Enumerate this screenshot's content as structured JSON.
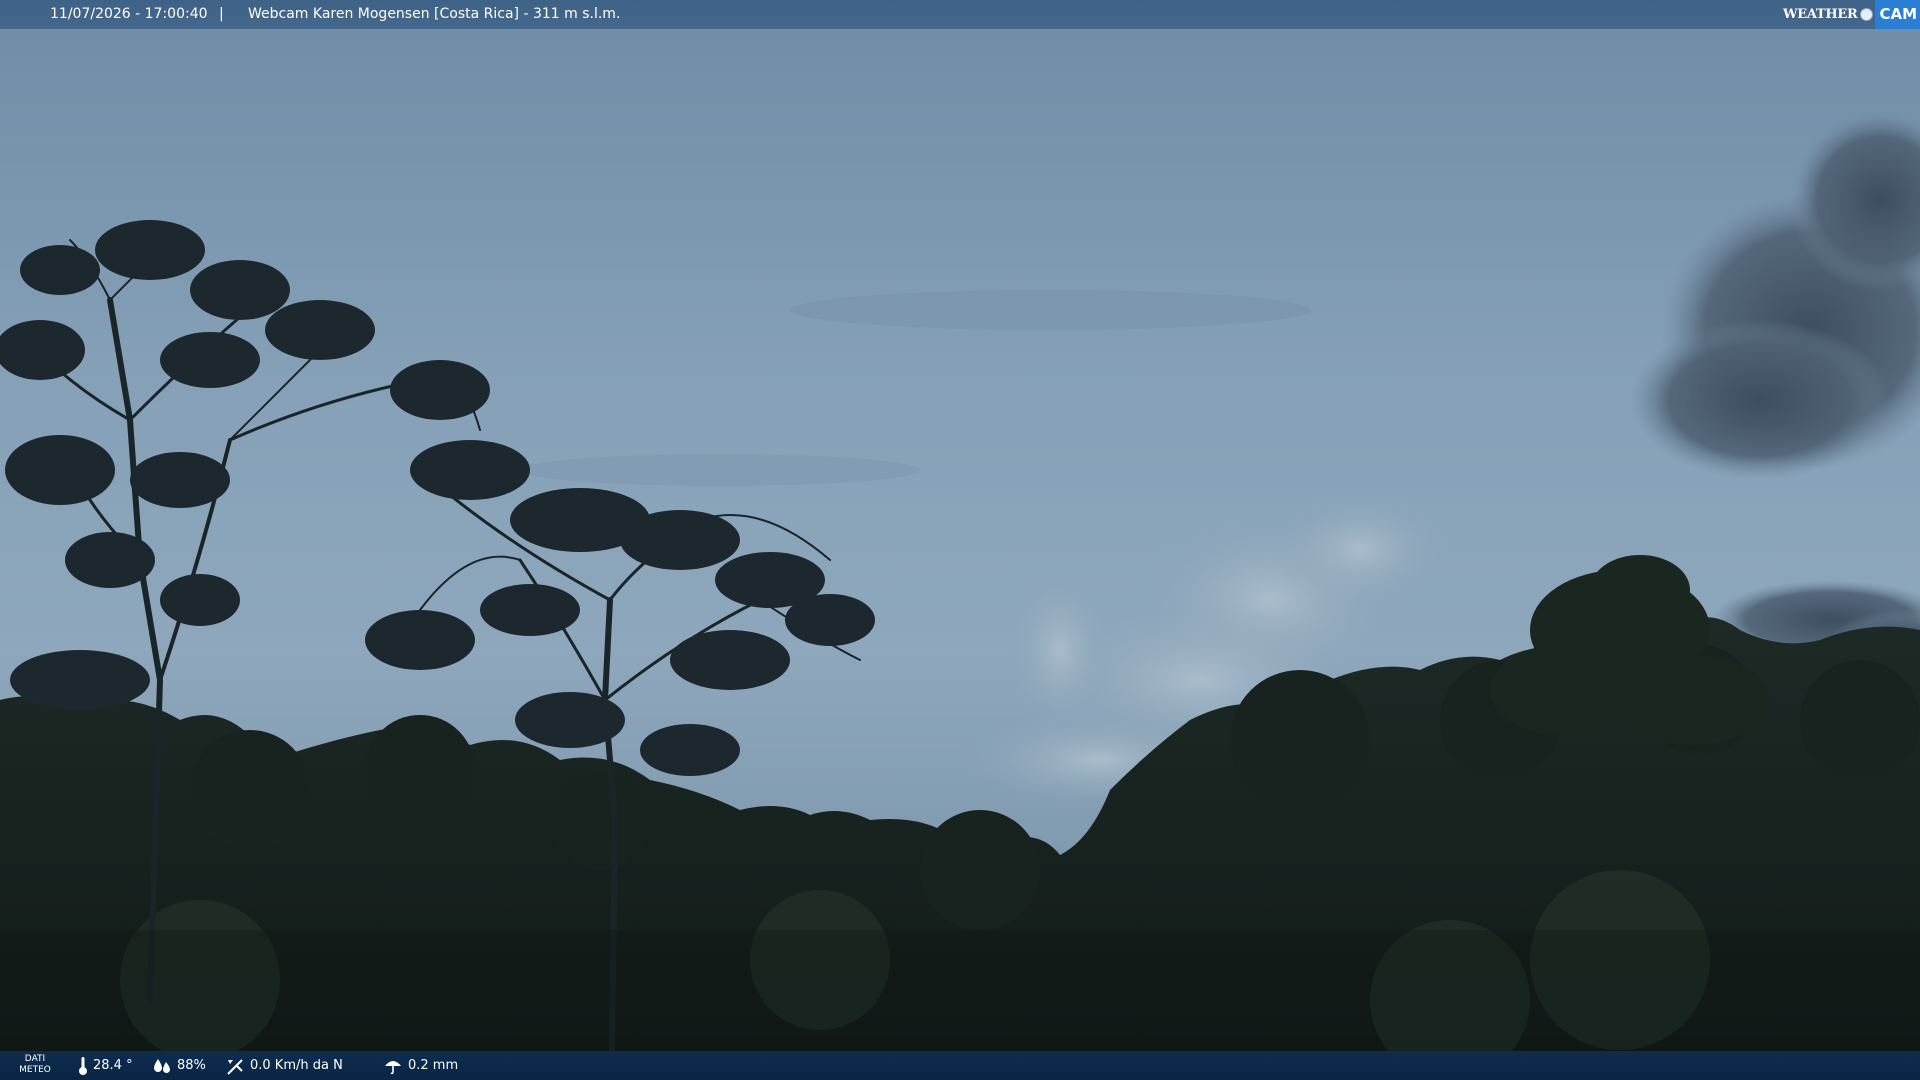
{
  "header": {
    "datetime": "11/07/2026 - 17:00:40",
    "separator": "|",
    "title": "Webcam Karen Mogensen [Costa Rica]  - 311 m s.l.m."
  },
  "logo": {
    "word": "Weather",
    "cam": "CAM"
  },
  "weather_bar": {
    "label_line1": "DATI",
    "label_line2": "METEO",
    "temperature": "28.4 °",
    "humidity": "88%",
    "wind": "0.0 Km/h da N",
    "rain": "0.2 mm"
  },
  "icons": {
    "temperature": "thermometer-icon",
    "humidity": "humidity-drops-icon",
    "wind": "wind-vane-icon",
    "rain": "umbrella-icon"
  },
  "colors": {
    "top_bar": "#44678c",
    "bottom_bar": "#0c2a4c",
    "logo_accent": "#2a7fd4",
    "sky": "#7f9bb3",
    "forest": "#151f1c"
  }
}
